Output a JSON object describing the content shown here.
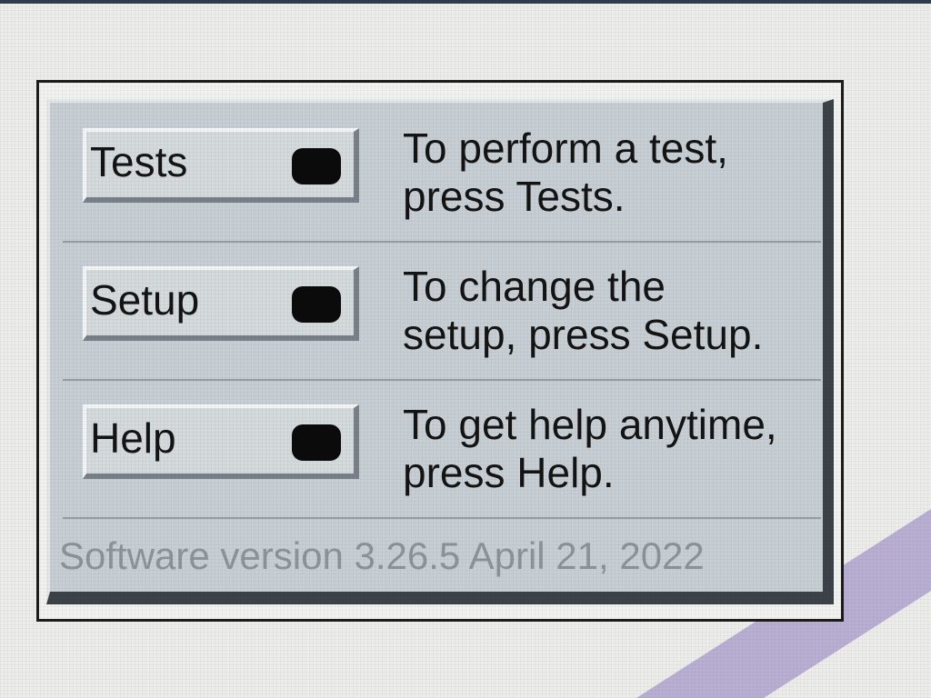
{
  "menu": {
    "items": [
      {
        "button_label": "Tests",
        "description_line1": "To perform a test,",
        "description_line2": "press Tests."
      },
      {
        "button_label": "Setup",
        "description_line1": "To change the",
        "description_line2": "setup, press Setup."
      },
      {
        "button_label": "Help",
        "description_line1": "To get help anytime,",
        "description_line2": "press Help."
      }
    ]
  },
  "footer": {
    "version_text": "Software version  3.26.5  April 21, 2022"
  },
  "colors": {
    "panel": "#c8cfd4",
    "button": "#d4dadd",
    "text": "#141414",
    "version_text": "#8d9499",
    "led": "#0b0b0b",
    "stripe": "#b9afd3"
  },
  "icons": [
    "indicator-led-icon"
  ]
}
